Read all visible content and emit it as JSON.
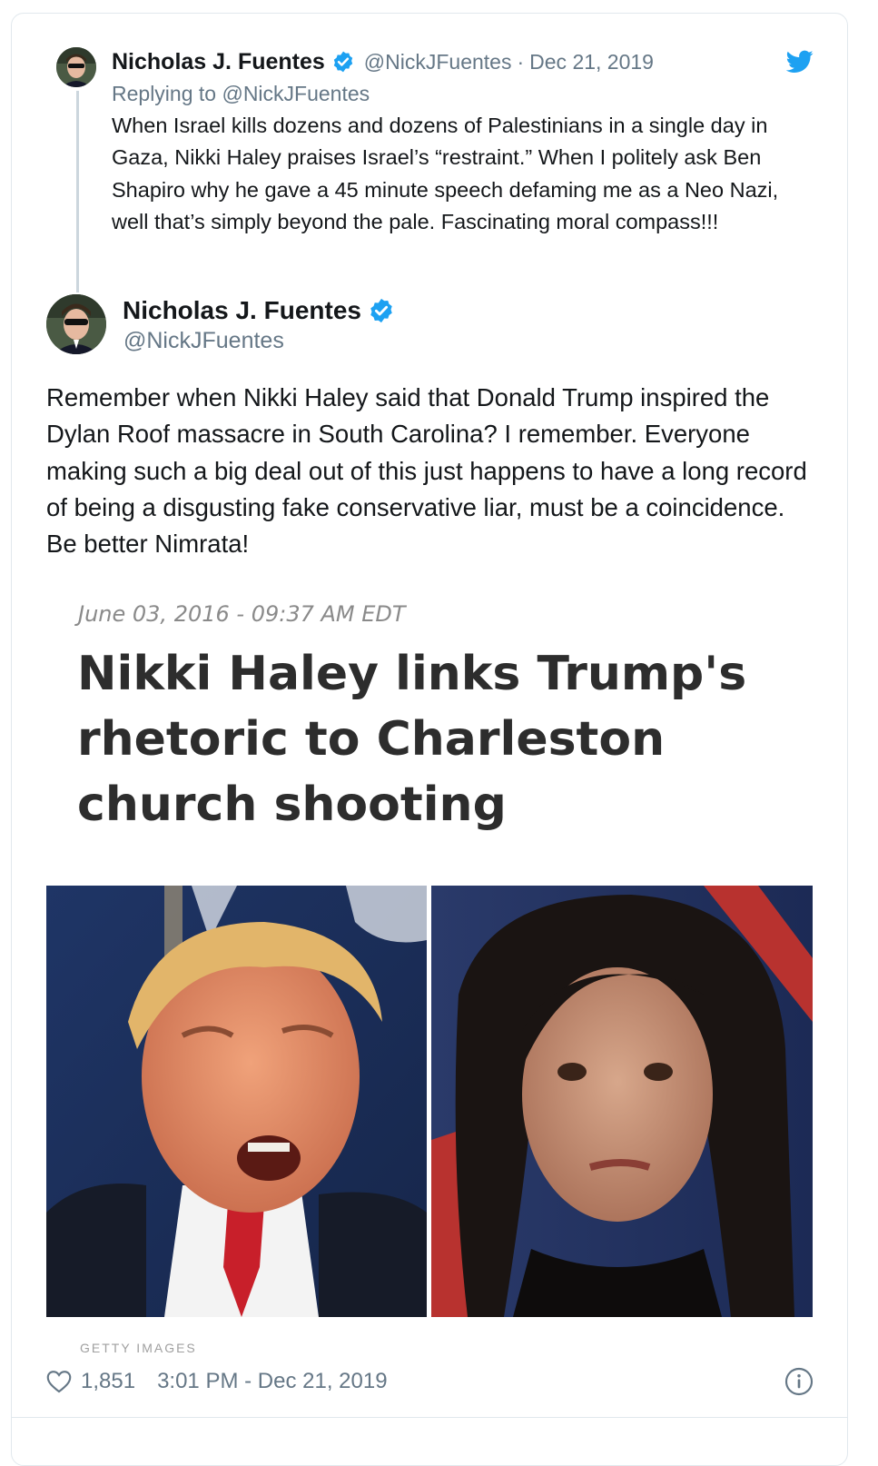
{
  "parent_tweet": {
    "author_name": "Nicholas J. Fuentes",
    "verified_icon": "verified-badge-icon",
    "handle": "@NickJFuentes",
    "separator": "·",
    "date": "Dec 21, 2019",
    "replying_prefix": "Replying to",
    "replying_to": "@NickJFuentes",
    "text": "When Israel kills dozens and dozens of Palestinians in a single day in Gaza, Nikki Haley praises Israel’s “restraint.” When I politely ask Ben Shapiro why he gave a 45 minute speech defaming me as a Neo Nazi, well that’s simply beyond the pale. Fascinating moral compass!!!"
  },
  "main_tweet": {
    "author_name": "Nicholas J. Fuentes",
    "handle": "@NickJFuentes",
    "text": "Remember when Nikki Haley said that Donald Trump inspired the Dylan Roof massacre in South Carolina? I remember. Everyone making such a big deal out of this just happens to have a long record of being a disgusting fake conservative liar, must be a coincidence. Be better Nimrata!"
  },
  "article": {
    "date": "June 03, 2016 - 09:37 AM EDT",
    "headline": "Nikki Haley links Trump's rhetoric to Charleston church shooting",
    "credit": "GETTY IMAGES"
  },
  "footer": {
    "likes": "1,851",
    "timestamp": "3:01 PM - Dec 21, 2019"
  },
  "colors": {
    "twitter_blue": "#1da1f2",
    "secondary_text": "#657786",
    "primary_text": "#14171a"
  }
}
